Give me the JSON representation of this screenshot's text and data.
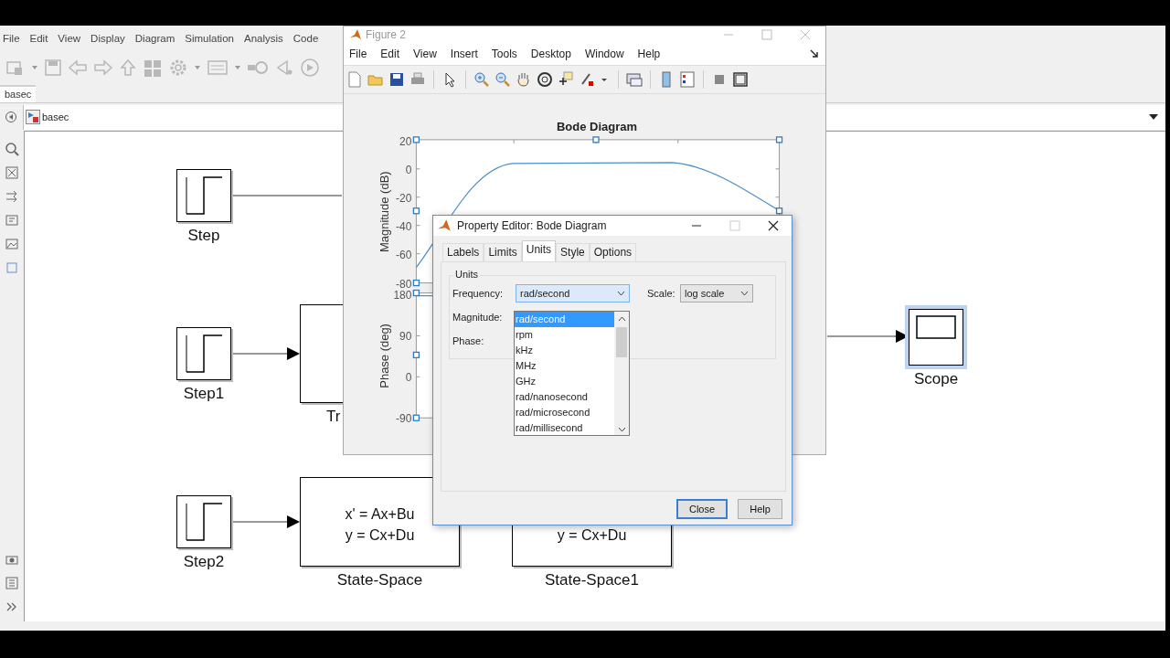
{
  "simulink": {
    "menu": [
      "File",
      "Edit",
      "View",
      "Display",
      "Diagram",
      "Simulation",
      "Analysis",
      "Code"
    ],
    "tabs": [
      {
        "label": "basec",
        "selected": true
      }
    ],
    "breadcrumb": "basec",
    "blocks": [
      {
        "kind": "step",
        "label": "Step",
        "selected": false
      },
      {
        "kind": "step",
        "label": "Step1",
        "selected": false
      },
      {
        "kind": "step",
        "label": "Step2",
        "selected": false
      },
      {
        "kind": "transfer_fcn",
        "label": "Tr",
        "selected": false
      },
      {
        "kind": "state_space",
        "lines": [
          "x' = Ax+Bu",
          "y = Cx+Du"
        ],
        "label": "State-Space",
        "selected": false
      },
      {
        "kind": "state_space",
        "lines": [
          "y = Cx+Du"
        ],
        "label": "State-Space1",
        "selected": false
      },
      {
        "kind": "scope",
        "label": "Scope",
        "selected": true
      }
    ]
  },
  "figure": {
    "title": "Figure 2",
    "menu": [
      "File",
      "Edit",
      "View",
      "Insert",
      "Tools",
      "Desktop",
      "Window",
      "Help"
    ],
    "plot": {
      "title": "Bode Diagram",
      "magnitude": {
        "label": "Magnitude (dB)",
        "ticks": [
          "20",
          "0",
          "-20",
          "-40",
          "-60",
          "-80"
        ]
      },
      "phase": {
        "label": "Phase (deg)",
        "ticks": [
          "180",
          "90",
          "0",
          "-90"
        ]
      }
    }
  },
  "dialog": {
    "title": "Property Editor: Bode Diagram",
    "tabs": [
      {
        "label": "Labels",
        "selected": false
      },
      {
        "label": "Limits",
        "selected": false
      },
      {
        "label": "Units",
        "selected": true
      },
      {
        "label": "Style",
        "selected": false
      },
      {
        "label": "Options",
        "selected": false
      }
    ],
    "group": "Units",
    "frequency": {
      "label": "Frequency:",
      "value": "rad/second"
    },
    "magnitude": {
      "label": "Magnitude:"
    },
    "phase": {
      "label": "Phase:"
    },
    "scale": {
      "label": "Scale:",
      "value": "log scale"
    },
    "options": [
      {
        "label": "rad/second",
        "selected": true
      },
      {
        "label": "rpm",
        "selected": false
      },
      {
        "label": "kHz",
        "selected": false
      },
      {
        "label": "MHz",
        "selected": false
      },
      {
        "label": "GHz",
        "selected": false
      },
      {
        "label": "rad/nanosecond",
        "selected": false
      },
      {
        "label": "rad/microsecond",
        "selected": false
      },
      {
        "label": "rad/millisecond",
        "selected": false
      }
    ],
    "buttons": [
      {
        "label": "Close",
        "focused": true
      },
      {
        "label": "Help",
        "focused": false
      }
    ]
  }
}
